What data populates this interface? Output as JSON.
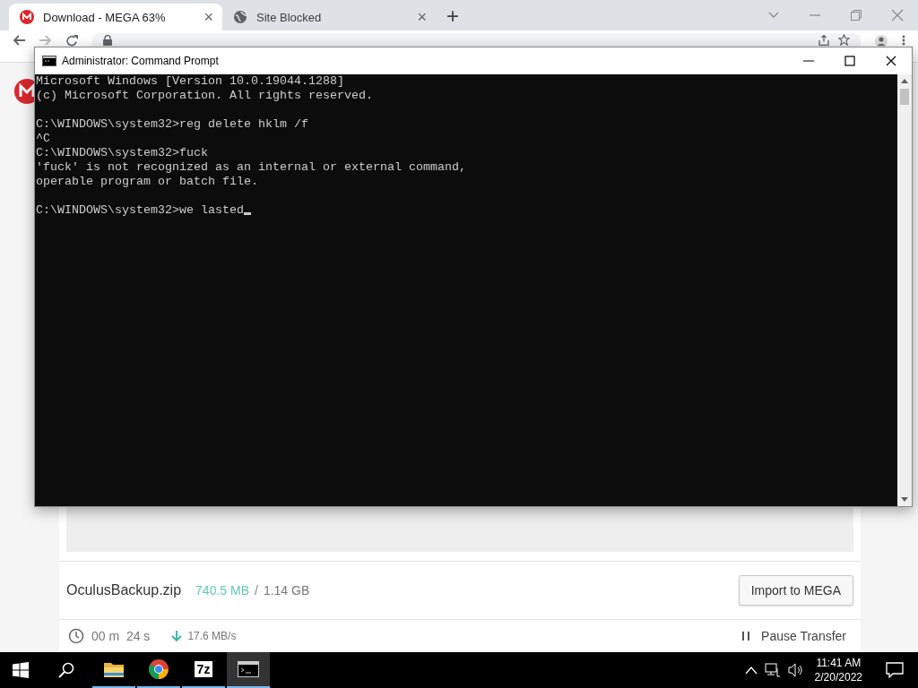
{
  "browser": {
    "tabs": [
      {
        "title": "Download - MEGA 63%",
        "close": "×",
        "selected": true,
        "kind": "mega"
      },
      {
        "title": "Site Blocked",
        "close": "×",
        "selected": false,
        "kind": "globe"
      }
    ],
    "new_tab": "+"
  },
  "page": {
    "file_name": "OculusBackup.zip",
    "downloaded": "740.5 MB",
    "separator": "/",
    "total": "1.14 GB",
    "import_button": "Import to MEGA",
    "time_left": "00 m  24 s",
    "speed": "17.6 MB/s",
    "pause_button": "Pause Transfer"
  },
  "console": {
    "title": "Administrator: Command Prompt",
    "blocks": [
      [
        "Microsoft Windows [Version 10.0.19044.1288]",
        "(c) Microsoft Corporation. All rights reserved."
      ],
      [
        "C:\\WINDOWS\\system32>reg delete hklm /f",
        "^C",
        "C:\\WINDOWS\\system32>fuck",
        "'fuck' is not recognized as an internal or external command,",
        "operable program or batch file."
      ],
      [
        "C:\\WINDOWS\\system32>we lasted"
      ]
    ],
    "cursor": true
  },
  "taskbar": {
    "apps": [
      {
        "kind": "explorer",
        "active": false
      },
      {
        "kind": "chrome",
        "active": false
      },
      {
        "kind": "archiver",
        "label": "7z",
        "active": false
      },
      {
        "kind": "cmd",
        "active": true
      }
    ],
    "time": "11:41 AM",
    "date": "2/20/2022"
  }
}
